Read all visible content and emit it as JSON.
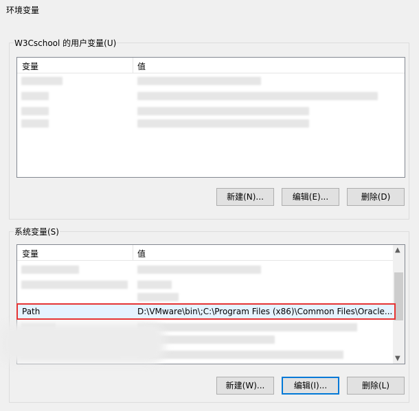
{
  "window": {
    "title": "环境变量"
  },
  "user_vars": {
    "legend": "W3Cschool 的用户变量(U)",
    "col_variable": "变量",
    "col_value": "值",
    "buttons": {
      "new": "新建(N)...",
      "edit": "编辑(E)...",
      "delete": "删除(D)"
    }
  },
  "system_vars": {
    "legend": "系统变量(S)",
    "col_variable": "变量",
    "col_value": "值",
    "selected_row": {
      "variable": "Path",
      "value": "D:\\VMware\\bin\\;C:\\Program Files (x86)\\Common Files\\Oracle..."
    },
    "buttons": {
      "new": "新建(W)...",
      "edit": "编辑(I)...",
      "delete": "删除(L)"
    }
  },
  "colors": {
    "selection_border": "#e53333",
    "selection_bg": "#e5f3ff",
    "focus_border": "#0078d7"
  }
}
